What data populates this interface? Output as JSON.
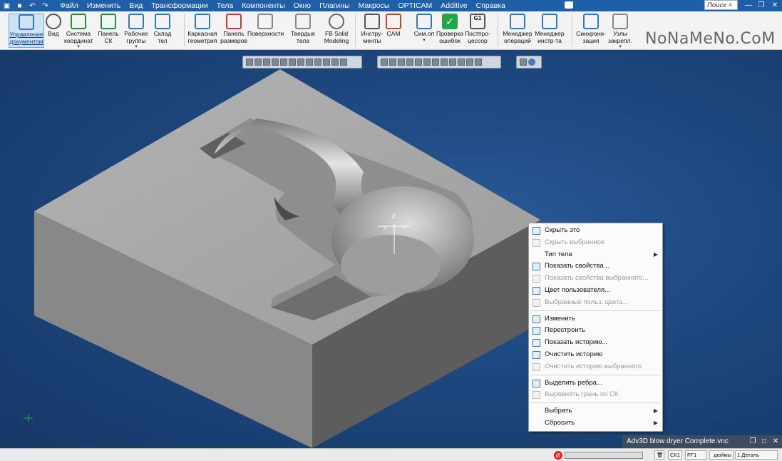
{
  "menubar": {
    "items": [
      "Файл",
      "Изменить",
      "Вид",
      "Трансформации",
      "Тела",
      "Компоненты",
      "Окно",
      "Плагины",
      "Макросы",
      "OPTICAM",
      "Additive",
      "Справка"
    ],
    "search_placeholder": "Поиск"
  },
  "ribbon": {
    "buttons": [
      {
        "label": "Управление\nдокументом",
        "icon": "document-management-icon"
      },
      {
        "label": "Вид",
        "icon": "view-sphere-icon"
      },
      {
        "label": "Система\nкоординат",
        "icon": "coordinate-system-icon"
      },
      {
        "label": "Панель СК",
        "icon": "cs-panel-icon"
      },
      {
        "label": "Рабочие\nгруппы",
        "icon": "work-groups-icon"
      },
      {
        "label": "Склад тел",
        "icon": "body-storage-icon"
      },
      {
        "label": "Каркасная\nгеометрия",
        "icon": "wireframe-icon"
      },
      {
        "label": "Панель\nразмеров",
        "icon": "dimensions-panel-icon"
      },
      {
        "label": "Поверхности",
        "icon": "surfaces-icon"
      },
      {
        "label": "Твердые тела",
        "icon": "solids-icon"
      },
      {
        "label": "FB Solid\nModeling",
        "icon": "fb-solid-icon"
      },
      {
        "label": "Инстру-\nменты",
        "icon": "tools-icon"
      },
      {
        "label": "CAM",
        "icon": "cam-icon"
      },
      {
        "label": "Сим.оп",
        "icon": "simulation-icon"
      },
      {
        "label": "Проверка\nошибок",
        "icon": "check-errors-icon"
      },
      {
        "label": "Постпро-\nцессор",
        "icon": "postprocessor-icon"
      },
      {
        "label": "Менеджер\nопераций",
        "icon": "operations-manager-icon"
      },
      {
        "label": "Менеджер\nинстр-та",
        "icon": "tool-manager-icon"
      },
      {
        "label": "Синхрони-\nзация",
        "icon": "sync-icon"
      },
      {
        "label": "Узлы\nзакрепл.",
        "icon": "fixtures-icon"
      }
    ],
    "postprocessor_badge": "G1"
  },
  "watermark": "NoNaMeNo.CoM",
  "viewport": {
    "axis_labels": [
      "Z",
      "X",
      "Y"
    ]
  },
  "context_menu": {
    "items": [
      {
        "label": "Скрыть это",
        "enabled": true,
        "icon": "hide-icon"
      },
      {
        "label": "Скрыть выбранное",
        "enabled": false,
        "icon": "hide-selected-icon"
      },
      {
        "label": "Тип тела",
        "enabled": true,
        "submenu": true
      },
      {
        "label": "Показать свойства...",
        "enabled": true,
        "icon": "properties-icon"
      },
      {
        "label": "Показать свойства выбранного...",
        "enabled": false,
        "icon": "properties-selected-icon"
      },
      {
        "label": "Цвет пользователя...",
        "enabled": true,
        "icon": "user-color-icon"
      },
      {
        "label": "Выбранные польз. цвета...",
        "enabled": false,
        "icon": "selected-colors-icon"
      },
      {
        "label": "Изменить",
        "enabled": true,
        "icon": "edit-icon"
      },
      {
        "label": "Перестроить",
        "enabled": true,
        "icon": "rebuild-icon"
      },
      {
        "label": "Показать историю...",
        "enabled": true,
        "icon": "history-icon"
      },
      {
        "label": "Очистить историю",
        "enabled": true,
        "icon": "clear-history-icon"
      },
      {
        "label": "Очистить историю выбранного",
        "enabled": false,
        "icon": "clear-history-selected-icon"
      },
      {
        "label": "Выделить ребра...",
        "enabled": true,
        "icon": "select-edges-icon"
      },
      {
        "label": "Выровнять грань по СК",
        "enabled": false,
        "icon": "align-face-icon"
      },
      {
        "label": "Выбрать",
        "enabled": true,
        "submenu": true
      },
      {
        "label": "Сбросить",
        "enabled": true,
        "submenu": true
      }
    ]
  },
  "doc_window": {
    "title": "Adv3D blow dryer Complete.vnc"
  },
  "statusbar": {
    "cs": "СК1",
    "wg": "РГ1",
    "units": "дюймы",
    "parts": "1 Деталь"
  },
  "colors": {
    "menubar": "#1f5fa8",
    "viewport_bg": "#1d4880",
    "part_top": "#a9a9a9",
    "part_front": "#8a8a8a",
    "part_side": "#5a5a5a"
  }
}
